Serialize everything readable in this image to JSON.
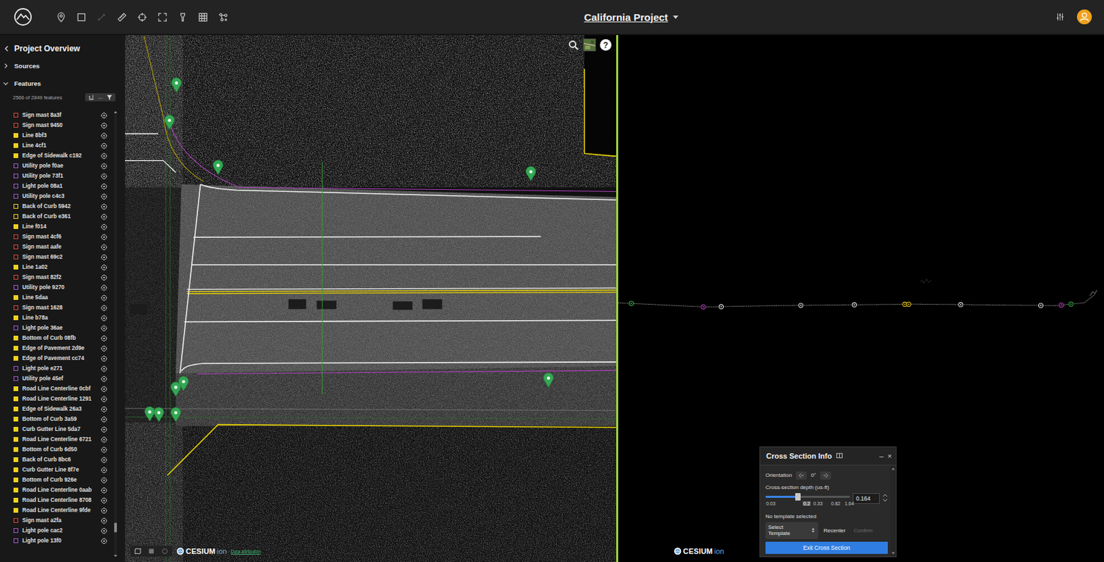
{
  "topbar": {
    "title": "California Project",
    "tools": [
      {
        "disabled": false
      },
      {
        "disabled": false
      },
      {
        "disabled": true
      },
      {
        "disabled": false
      },
      {
        "disabled": false
      },
      {
        "disabled": false
      },
      {
        "disabled": false
      },
      {
        "disabled": false
      },
      {
        "disabled": false
      }
    ]
  },
  "sidebar": {
    "title": "Project Overview",
    "sections": [
      {
        "label": "Sources",
        "expanded": false
      },
      {
        "label": "Features",
        "expanded": true
      }
    ],
    "count": "2566 of 2849 features",
    "more": "...",
    "scroll_level": 0.95,
    "items": [
      {
        "label": "Sign mast 8a3f",
        "kind": "outline",
        "color": "#d9443a"
      },
      {
        "label": "Sign mast 9450",
        "kind": "outline",
        "color": "#d9443a"
      },
      {
        "label": "Line 8bf3",
        "kind": "filled",
        "color": "#f2d21b"
      },
      {
        "label": "Line 4cf1",
        "kind": "filled",
        "color": "#f2d21b"
      },
      {
        "label": "Edge of Sidewalk c192",
        "kind": "filled",
        "color": "#f2d21b"
      },
      {
        "label": "Utility pole f0ae",
        "kind": "outline",
        "color": "#a058d0"
      },
      {
        "label": "Utility pole 73f1",
        "kind": "outline",
        "color": "#a058d0"
      },
      {
        "label": "Light pole 08a1",
        "kind": "outline",
        "color": "#a058d0"
      },
      {
        "label": "Utility pole c4c3",
        "kind": "outline",
        "color": "#a058d0"
      },
      {
        "label": "Back of Curb 5942",
        "kind": "outline",
        "color": "#f2d21b"
      },
      {
        "label": "Back of Curb e361",
        "kind": "outline",
        "color": "#f2d21b"
      },
      {
        "label": "Line f014",
        "kind": "filled",
        "color": "#f2d21b"
      },
      {
        "label": "Sign mast 4cf6",
        "kind": "outline",
        "color": "#d9443a"
      },
      {
        "label": "Sign mast aafe",
        "kind": "outline",
        "color": "#d9443a"
      },
      {
        "label": "Sign mast 69c2",
        "kind": "outline",
        "color": "#d9443a"
      },
      {
        "label": "Line 1a02",
        "kind": "filled",
        "color": "#f2d21b"
      },
      {
        "label": "Sign mast 82f2",
        "kind": "outline",
        "color": "#d9443a"
      },
      {
        "label": "Utility pole 9270",
        "kind": "outline",
        "color": "#a058d0"
      },
      {
        "label": "Line 5daa",
        "kind": "filled",
        "color": "#f2d21b"
      },
      {
        "label": "Sign mast 1628",
        "kind": "outline",
        "color": "#d9443a"
      },
      {
        "label": "Line b78a",
        "kind": "filled",
        "color": "#f2d21b"
      },
      {
        "label": "Light pole 36ae",
        "kind": "outline",
        "color": "#a058d0"
      },
      {
        "label": "Bottom of Curb 08fb",
        "kind": "filled",
        "color": "#f2d21b"
      },
      {
        "label": "Edge of Pavement 2d9e",
        "kind": "filled",
        "color": "#f2d21b"
      },
      {
        "label": "Edge of Pavement cc74",
        "kind": "filled",
        "color": "#f2d21b"
      },
      {
        "label": "Light pole e271",
        "kind": "outline",
        "color": "#a058d0"
      },
      {
        "label": "Utility pole 45ef",
        "kind": "outline",
        "color": "#a058d0"
      },
      {
        "label": "Road Line Centerline 0cbf",
        "kind": "filled",
        "color": "#f2d21b"
      },
      {
        "label": "Road Line Centerline 1291",
        "kind": "filled",
        "color": "#f2d21b"
      },
      {
        "label": "Edge of Sidewalk 26a3",
        "kind": "filled",
        "color": "#f2d21b"
      },
      {
        "label": "Bottom of Curb 3a59",
        "kind": "filled",
        "color": "#f2d21b"
      },
      {
        "label": "Curb Gutter Line 5da7",
        "kind": "filled",
        "color": "#f2d21b"
      },
      {
        "label": "Road Line Centerline 6721",
        "kind": "filled",
        "color": "#f2d21b"
      },
      {
        "label": "Bottom of Curb 6d50",
        "kind": "filled",
        "color": "#f2d21b"
      },
      {
        "label": "Back of Curb 8bc6",
        "kind": "filled",
        "color": "#f2d21b"
      },
      {
        "label": "Curb Gutter Line 8f7e",
        "kind": "filled",
        "color": "#f2d21b"
      },
      {
        "label": "Bottom of Curb 926e",
        "kind": "filled",
        "color": "#f2d21b"
      },
      {
        "label": "Road Line Centerline 0aab",
        "kind": "filled",
        "color": "#f2d21b"
      },
      {
        "label": "Road Line Centerline 8708",
        "kind": "filled",
        "color": "#f2d21b"
      },
      {
        "label": "Road Line Centerline 9fde",
        "kind": "filled",
        "color": "#f2d21b"
      },
      {
        "label": "Sign mast a2fa",
        "kind": "outline",
        "color": "#d9443a"
      },
      {
        "label": "Light pole cac2",
        "kind": "outline",
        "color": "#a058d0"
      },
      {
        "label": "Light pole 13f0",
        "kind": "outline",
        "color": "#a058d0"
      }
    ]
  },
  "map": {
    "help": "?",
    "brand": "CESIUM",
    "brand_suffix": "ion",
    "attribution": "Data attribution"
  },
  "cross_section": {
    "markers": [
      {
        "station": 0.027,
        "color": "#3cb44b"
      },
      {
        "station": 0.175,
        "color": "#c040c0"
      },
      {
        "station": 0.212,
        "color": "#e0e0e0"
      },
      {
        "station": 0.376,
        "color": "#e0e0e0"
      },
      {
        "station": 0.486,
        "color": "#e0e0e0"
      },
      {
        "station": 0.59,
        "color": "#e6c619"
      },
      {
        "station": 0.598,
        "color": "#e6c619"
      },
      {
        "station": 0.705,
        "color": "#e0e0e0"
      },
      {
        "station": 0.87,
        "color": "#e0e0e0"
      },
      {
        "station": 0.912,
        "color": "#c040c0"
      },
      {
        "station": 0.932,
        "color": "#3cb44b"
      }
    ]
  },
  "panel": {
    "title": "Cross Section Info",
    "minimize": "–",
    "close": "×",
    "orientation_label": "Orientation",
    "angle": "0°",
    "depth_label": "Cross-section depth (us-ft)",
    "level": 0.38,
    "ticks": [
      {
        "label": "0.03",
        "selected": false
      },
      {
        "label": "0.2",
        "selected": true
      },
      {
        "label": "0.33",
        "selected": false
      },
      {
        "label": "0.82",
        "selected": false
      },
      {
        "label": "1.64",
        "selected": false
      }
    ],
    "value": "0.164",
    "template_status": "No template selected",
    "template_placeholder": "Select Template",
    "buttons": [
      {
        "label": "Recenter",
        "disabled": false
      },
      {
        "label": "Confirm",
        "disabled": true
      }
    ],
    "exit": "Exit Cross Section"
  }
}
